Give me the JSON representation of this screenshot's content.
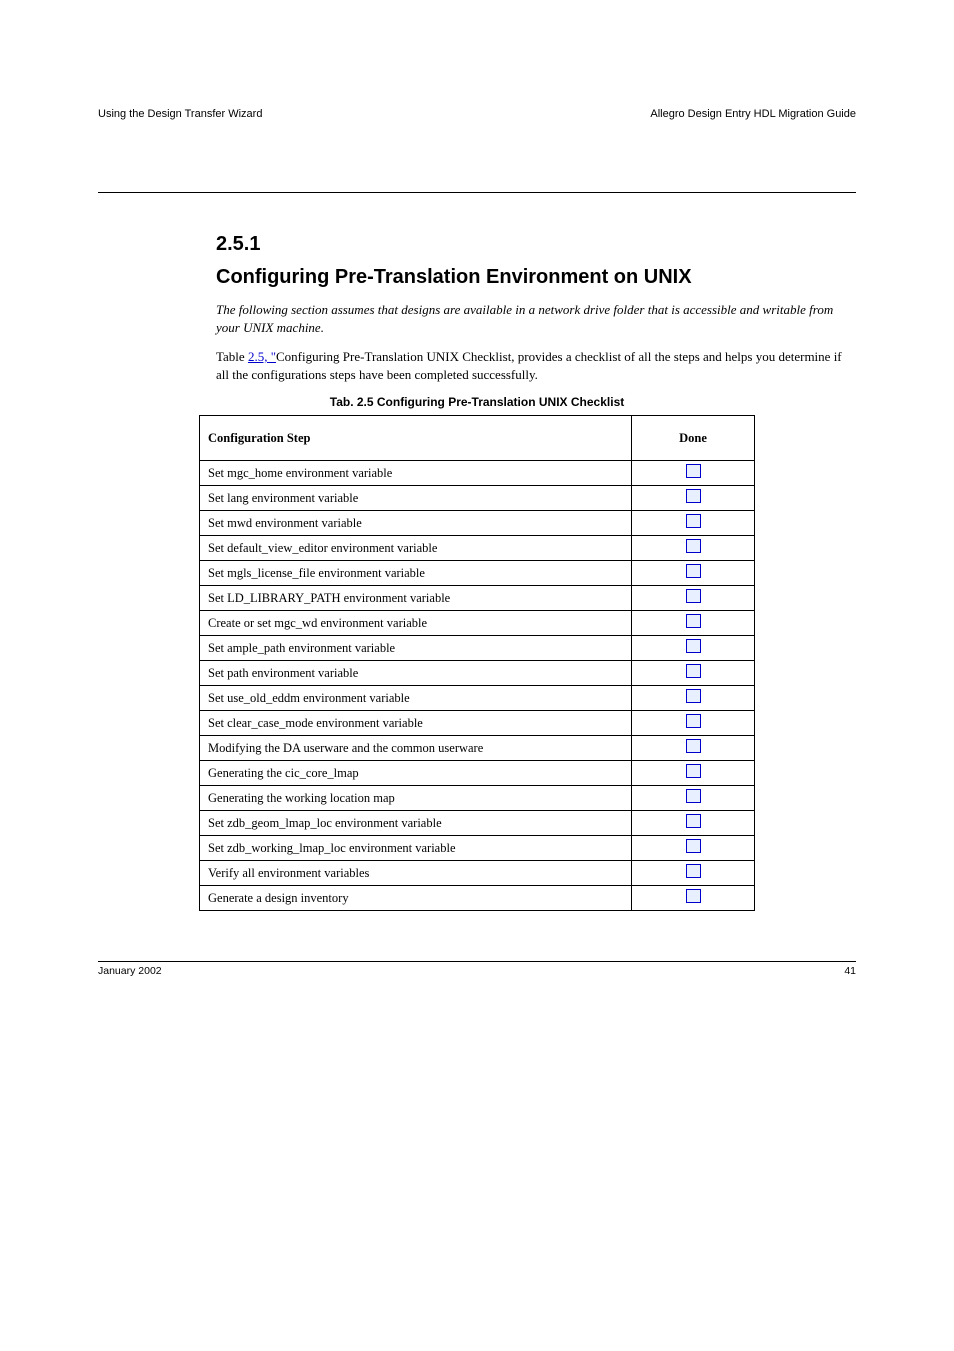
{
  "header": {
    "left": "Using the Design Transfer Wizard",
    "right": "Allegro Design Entry HDL Migration Guide"
  },
  "section": {
    "number": "2.5.1",
    "title": "Configuring Pre-Translation Environment on UNIX",
    "intro_italic": "The following section assumes that designs are available in a network drive folder that is accessible and writable from your UNIX machine.",
    "para1_before_link": "Table ",
    "para1_link": "2.5, \"",
    "para1_after_link": "Configuring Pre-Translation UNIX Checklist, provides a checklist of all the steps and helps you determine if all the configurations steps have been completed successfully."
  },
  "table": {
    "caption": "Tab. 2.5 Configuring Pre-Translation UNIX Checklist",
    "headers": {
      "step": "Configuration Step",
      "done": "Done"
    },
    "rows": [
      "Set mgc_home environment variable",
      "Set lang environment variable",
      "Set mwd environment variable",
      "Set default_view_editor environment variable",
      "Set mgls_license_file environment variable",
      "Set LD_LIBRARY_PATH environment variable",
      "Create or set mgc_wd environment variable",
      "Set ample_path environment variable",
      "Set path environment variable",
      "Set use_old_eddm environment variable",
      "Set clear_case_mode environment variable",
      "Modifying the DA userware and the common userware",
      "Generating the cic_core_lmap",
      "Generating the working location map",
      "Set zdb_geom_lmap_loc environment variable",
      "Set zdb_working_lmap_loc environment variable",
      "Verify all environment variables",
      "Generate a design inventory"
    ]
  },
  "footer": {
    "left": "January 2002",
    "right": "41"
  }
}
